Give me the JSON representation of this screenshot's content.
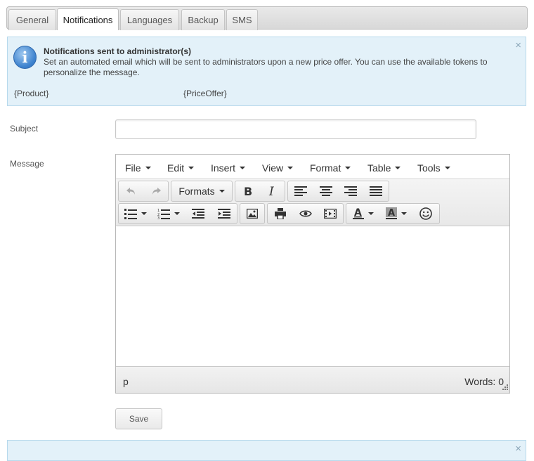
{
  "tabs": [
    {
      "label": "General"
    },
    {
      "label": "Notifications",
      "active": true
    },
    {
      "label": "Languages"
    },
    {
      "label": "Backup"
    },
    {
      "label": "SMS"
    }
  ],
  "info": {
    "title": "Notifications sent to administrator(s)",
    "text": "Set an automated email which will be sent to administrators upon a new price offer. You can use the available tokens to personalize the message.",
    "tokens": [
      "{Product}",
      "{PriceOffer}"
    ],
    "close": "×",
    "icon_glyph": "i"
  },
  "form": {
    "subject_label": "Subject",
    "subject_value": "",
    "message_label": "Message",
    "save_label": "Save"
  },
  "editor": {
    "menus": [
      "File",
      "Edit",
      "Insert",
      "View",
      "Format",
      "Table",
      "Tools"
    ],
    "formats_label": "Formats",
    "path": "p",
    "word_count": "Words: 0",
    "content": ""
  },
  "info2": {
    "close": "×"
  }
}
